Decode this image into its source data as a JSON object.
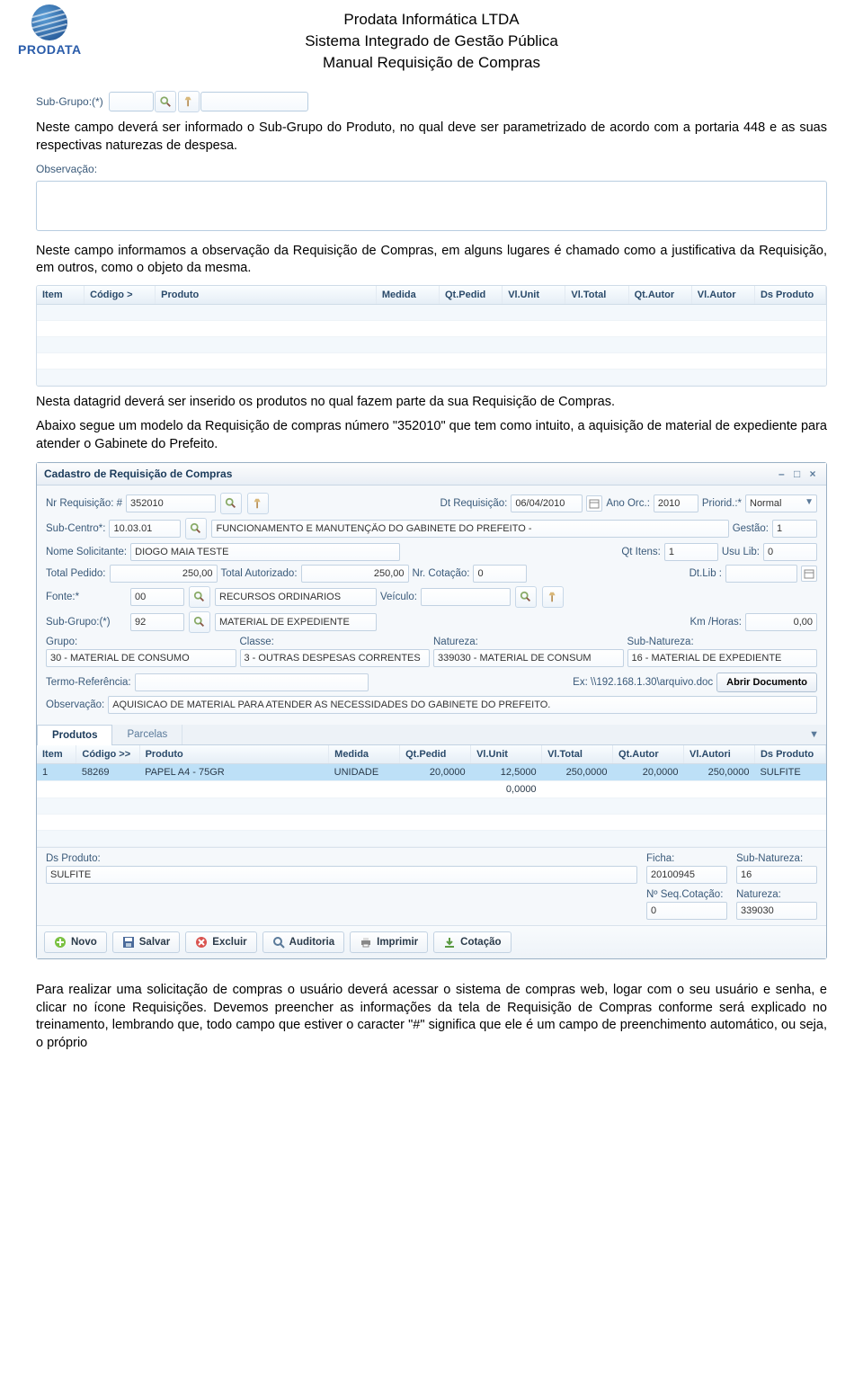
{
  "header": {
    "company": "Prodata Informática LTDA",
    "system": "Sistema Integrado de Gestão Pública",
    "manual": "Manual Requisição de Compras",
    "logo_text": "PRODATA"
  },
  "subgrupo": {
    "label": "Sub-Grupo:(*)"
  },
  "para1": "Neste campo deverá ser informado o Sub-Grupo do Produto, no qual deve ser parametrizado de acordo com a portaria 448 e as suas respectivas naturezas de despesa.",
  "observacao": {
    "label": "Observação:"
  },
  "para2": "Neste campo informamos a observação da Requisição de Compras, em alguns lugares é chamado como a justificativa da Requisição, em outros, como o objeto da mesma.",
  "grid1_headers": [
    "Item",
    "Código >",
    "Produto",
    "Medida",
    "Qt.Pedid",
    "Vl.Unit",
    "Vl.Total",
    "Qt.Autor",
    "Vl.Autor",
    "Ds Produto"
  ],
  "para3": "Nesta datagrid deverá ser inserido os produtos no qual fazem parte da sua Requisição de Compras.",
  "para4": "Abaixo segue um modelo da Requisição de compras número \"352010\" que tem como intuito, a aquisição de material de expediente para atender o Gabinete do Prefeito.",
  "win": {
    "title": "Cadastro de Requisição de Compras",
    "labels": {
      "nr_req": "Nr Requisição: #",
      "dt_req": "Dt Requisição:",
      "ano_orc": "Ano Orc.:",
      "priorid": "Priorid.:*",
      "sub_centro": "Sub-Centro*:",
      "gestao": "Gestão:",
      "nome_sol": "Nome Solicitante:",
      "qt_itens": "Qt Itens:",
      "usu_lib": "Usu Lib:",
      "total_ped": "Total Pedido:",
      "total_aut": "Total Autorizado:",
      "nr_cot": "Nr. Cotação:",
      "dt_lib": "Dt.Lib :",
      "fonte": "Fonte:*",
      "veiculo": "Veículo:",
      "sub_grupo": "Sub-Grupo:(*)",
      "km_horas": "Km /Horas:",
      "grupo": "Grupo:",
      "classe": "Classe:",
      "natureza": "Natureza:",
      "sub_nat": "Sub-Natureza:",
      "termo": "Termo-Referência:",
      "ex": "Ex: \\\\192.168.1.30\\arquivo.doc",
      "abrir": "Abrir Documento",
      "obs": "Observação:"
    },
    "values": {
      "nr_req": "352010",
      "dt_req": "06/04/2010",
      "ano_orc": "2010",
      "priorid": "Normal",
      "sub_centro_code": "10.03.01",
      "sub_centro_desc": "FUNCIONAMENTO E MANUTENÇÃO DO GABINETE DO PREFEITO -",
      "gestao": "1",
      "nome_sol": "DIOGO MAIA TESTE",
      "qt_itens": "1",
      "usu_lib": "0",
      "total_ped": "250,00",
      "total_aut": "250,00",
      "nr_cot": "0",
      "dt_lib": "",
      "fonte_code": "00",
      "fonte_desc": "RECURSOS ORDINARIOS",
      "veiculo": "",
      "sub_grupo_code": "92",
      "sub_grupo_desc": "MATERIAL DE EXPEDIENTE",
      "km_horas": "0,00",
      "grupo": "30 - MATERIAL DE CONSUMO",
      "classe": "3 - OUTRAS DESPESAS CORRENTES",
      "natureza": "339030 - MATERIAL DE CONSUM",
      "sub_nat": "16 - MATERIAL DE EXPEDIENTE",
      "termo": "",
      "obs": "AQUISICAO DE MATERIAL PARA ATENDER AS NECESSIDADES DO GABINETE DO PREFEITO."
    },
    "tabs": {
      "produtos": "Produtos",
      "parcelas": "Parcelas"
    },
    "grid_headers": [
      "Item",
      "Código >>",
      "Produto",
      "Medida",
      "Qt.Pedid",
      "Vl.Unit",
      "Vl.Total",
      "Qt.Autor",
      "Vl.Autori",
      "Ds Produto"
    ],
    "row": {
      "item": "1",
      "codigo": "58269",
      "produto": "PAPEL A4 - 75GR",
      "medida": "UNIDADE",
      "qtped": "20,0000",
      "vlunit": "12,5000",
      "vltotal": "250,0000",
      "qtautor": "20,0000",
      "vlautor": "250,0000",
      "ds": "SULFITE"
    },
    "row2": {
      "vlunit": "0,0000"
    },
    "footer": {
      "ds_label": "Ds Produto:",
      "ds_value": "SULFITE",
      "ficha_label": "Ficha:",
      "ficha_value": "20100945",
      "subnat_label": "Sub-Natureza:",
      "subnat_value": "16",
      "seq_label": "Nº Seq.Cotação:",
      "seq_value": "0",
      "nat_label": "Natureza:",
      "nat_value": "339030"
    },
    "toolbar": {
      "novo": "Novo",
      "salvar": "Salvar",
      "excluir": "Excluir",
      "auditoria": "Auditoria",
      "imprimir": "Imprimir",
      "cotacao": "Cotação"
    }
  },
  "para5": "Para realizar uma solicitação de compras o usuário deverá acessar o sistema de compras web, logar com o seu usuário e senha, e clicar no ícone Requisições. Devemos preencher as informações da tela de Requisição de Compras conforme será explicado no treinamento, lembrando que, todo campo que estiver o caracter \"#\" significa que ele é um campo de preenchimento automático, ou seja, o próprio"
}
